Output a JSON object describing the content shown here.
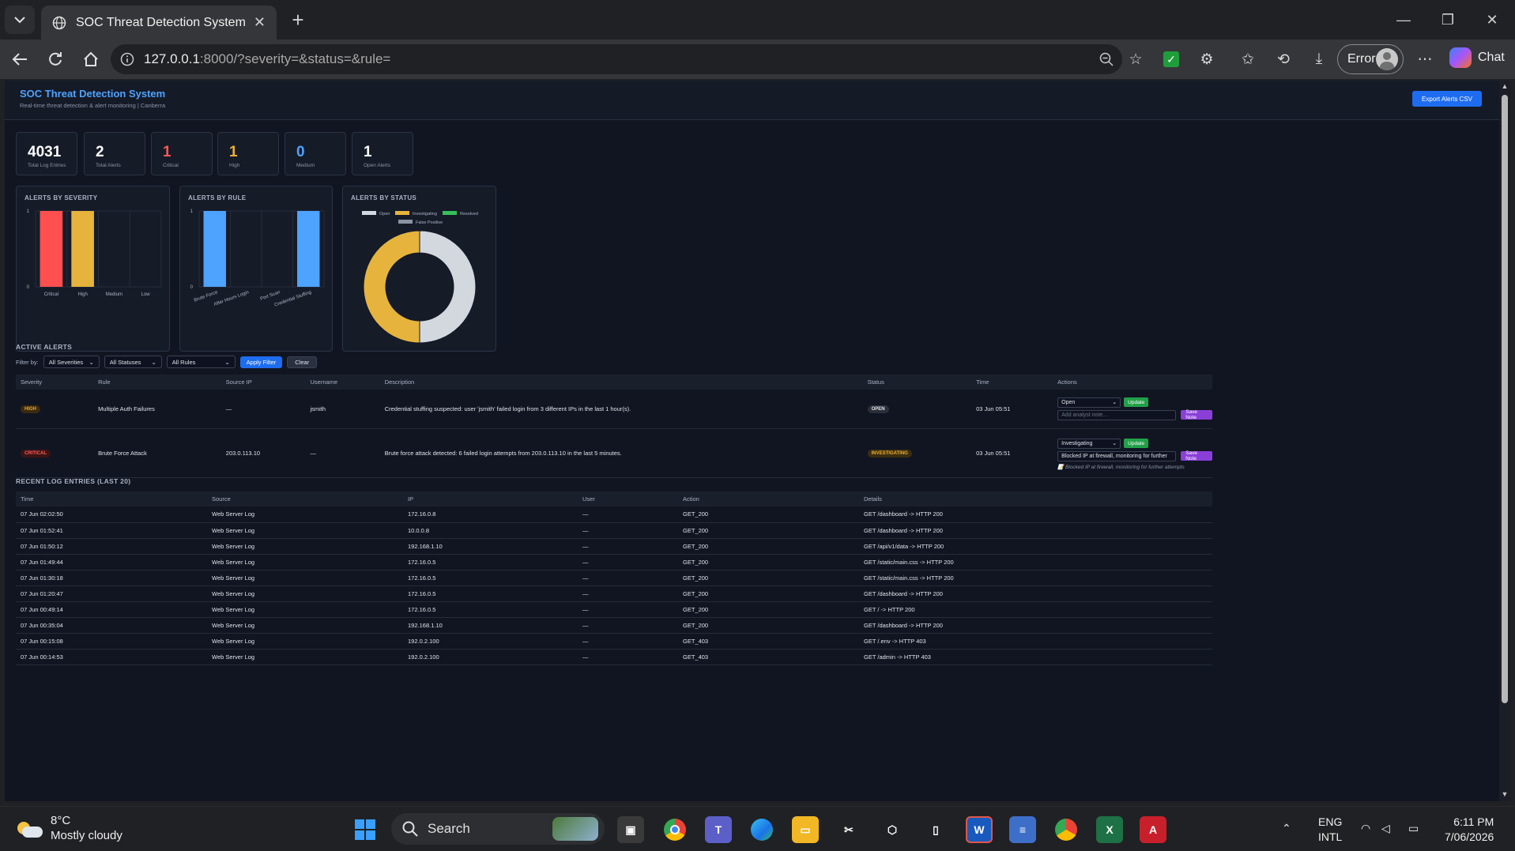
{
  "browser": {
    "tab_title": "SOC Threat Detection System",
    "url_host": "127.0.0.1",
    "url_rest": ":8000/?severity=&status=&rule=",
    "profile_label": "Error",
    "chat_label": "Chat"
  },
  "header": {
    "title": "SOC Threat Detection System",
    "subtitle": "Real-time threat detection & alert monitoring | Canberra",
    "export_label": "Export Alerts CSV"
  },
  "stats": [
    {
      "value": "4031",
      "label": "Total Log Entries",
      "color": "#ffffff"
    },
    {
      "value": "2",
      "label": "Total Alerts",
      "color": "#ffffff"
    },
    {
      "value": "1",
      "label": "Critical",
      "color": "#ff5a5a"
    },
    {
      "value": "1",
      "label": "High",
      "color": "#f0b030"
    },
    {
      "value": "0",
      "label": "Medium",
      "color": "#4da3ff"
    },
    {
      "value": "1",
      "label": "Open Alerts",
      "color": "#ffffff"
    }
  ],
  "chart_data": [
    {
      "type": "bar",
      "title": "ALERTS BY SEVERITY",
      "categories": [
        "Critical",
        "High",
        "Medium",
        "Low"
      ],
      "values": [
        1,
        1,
        0,
        0
      ],
      "colors": [
        "#ff4f4f",
        "#e6b43c",
        "#4da3ff",
        "#8b93a5"
      ],
      "ylim": [
        0,
        1
      ],
      "yticks": [
        "0",
        "1"
      ],
      "grid": true
    },
    {
      "type": "bar",
      "title": "ALERTS BY RULE",
      "categories": [
        "Brute Force",
        "After Hours Login",
        "Port Scan",
        "Credential Stuffing"
      ],
      "values": [
        1,
        0,
        0,
        1
      ],
      "colors": [
        "#4da3ff",
        "#4da3ff",
        "#4da3ff",
        "#4da3ff"
      ],
      "ylim": [
        0,
        1
      ],
      "yticks": [
        "0",
        "1"
      ],
      "grid": true
    },
    {
      "type": "pie",
      "title": "ALERTS BY STATUS",
      "categories": [
        "Open",
        "Investigating",
        "Resolved",
        "False Positive"
      ],
      "values": [
        1,
        1,
        0,
        0
      ],
      "colors": [
        "#d3d8df",
        "#e6b43c",
        "#34c05a",
        "#8b93a5"
      ],
      "legend": "top"
    }
  ],
  "alerts_section": {
    "title": "ACTIVE ALERTS",
    "filter_label": "Filter by:",
    "severity_select": "All Severities",
    "status_select": "All Statuses",
    "rule_select": "All Rules",
    "apply_label": "Apply Filter",
    "clear_label": "Clear",
    "columns": [
      "Severity",
      "Rule",
      "Source IP",
      "Username",
      "Description",
      "Status",
      "Time",
      "Actions"
    ],
    "rows": [
      {
        "severity": "HIGH",
        "rule": "Multiple Auth Failures",
        "source_ip": "—",
        "username": "jsmith",
        "description": "Credential stuffing suspected: user 'jsmith' failed login from 3 different IPs in the last 1 hour(s).",
        "status": "OPEN",
        "time": "03 Jun 05:51",
        "action_status": "Open",
        "update_label": "Update",
        "note_placeholder": "Add analyst note...",
        "note_value": "",
        "save_label": "Save Note",
        "saved_note": ""
      },
      {
        "severity": "CRITICAL",
        "rule": "Brute Force Attack",
        "source_ip": "203.0.113.10",
        "username": "—",
        "description": "Brute force attack detected: 6 failed login attempts from 203.0.113.10 in the last 5 minutes.",
        "status": "INVESTIGATING",
        "time": "03 Jun 05:51",
        "action_status": "Investigating",
        "update_label": "Update",
        "note_placeholder": "",
        "note_value": "Blocked IP at firewall, monitoring for further",
        "save_label": "Save Note",
        "saved_note": "📝 Blocked IP at firewall, monitoring for further attempts"
      }
    ]
  },
  "logs_section": {
    "title": "RECENT LOG ENTRIES (LAST 20)",
    "columns": [
      "Time",
      "Source",
      "IP",
      "User",
      "Action",
      "Details"
    ],
    "rows": [
      [
        "07 Jun 02:02:50",
        "Web Server Log",
        "172.16.0.8",
        "—",
        "GET_200",
        "GET /dashboard -> HTTP 200"
      ],
      [
        "07 Jun 01:52:41",
        "Web Server Log",
        "10.0.0.8",
        "—",
        "GET_200",
        "GET /dashboard -> HTTP 200"
      ],
      [
        "07 Jun 01:50:12",
        "Web Server Log",
        "192.168.1.10",
        "—",
        "GET_200",
        "GET /api/v1/data -> HTTP 200"
      ],
      [
        "07 Jun 01:49:44",
        "Web Server Log",
        "172.16.0.5",
        "—",
        "GET_200",
        "GET /static/main.css -> HTTP 200"
      ],
      [
        "07 Jun 01:30:18",
        "Web Server Log",
        "172.16.0.5",
        "—",
        "GET_200",
        "GET /static/main.css -> HTTP 200"
      ],
      [
        "07 Jun 01:20:47",
        "Web Server Log",
        "172.16.0.5",
        "—",
        "GET_200",
        "GET /dashboard -> HTTP 200"
      ],
      [
        "07 Jun 00:49:14",
        "Web Server Log",
        "172.16.0.5",
        "—",
        "GET_200",
        "GET / -> HTTP 200"
      ],
      [
        "07 Jun 00:35:04",
        "Web Server Log",
        "192.168.1.10",
        "—",
        "GET_200",
        "GET /dashboard -> HTTP 200"
      ],
      [
        "07 Jun 00:15:08",
        "Web Server Log",
        "192.0.2.100",
        "—",
        "GET_403",
        "GET /.env -> HTTP 403"
      ],
      [
        "07 Jun 00:14:53",
        "Web Server Log",
        "192.0.2.100",
        "—",
        "GET_403",
        "GET /admin -> HTTP 403"
      ]
    ]
  },
  "taskbar": {
    "temp": "8°C",
    "weather": "Mostly cloudy",
    "search_label": "Search",
    "lang1": "ENG",
    "lang2": "INTL",
    "time": "6:11 PM",
    "date": "7/06/2026"
  }
}
